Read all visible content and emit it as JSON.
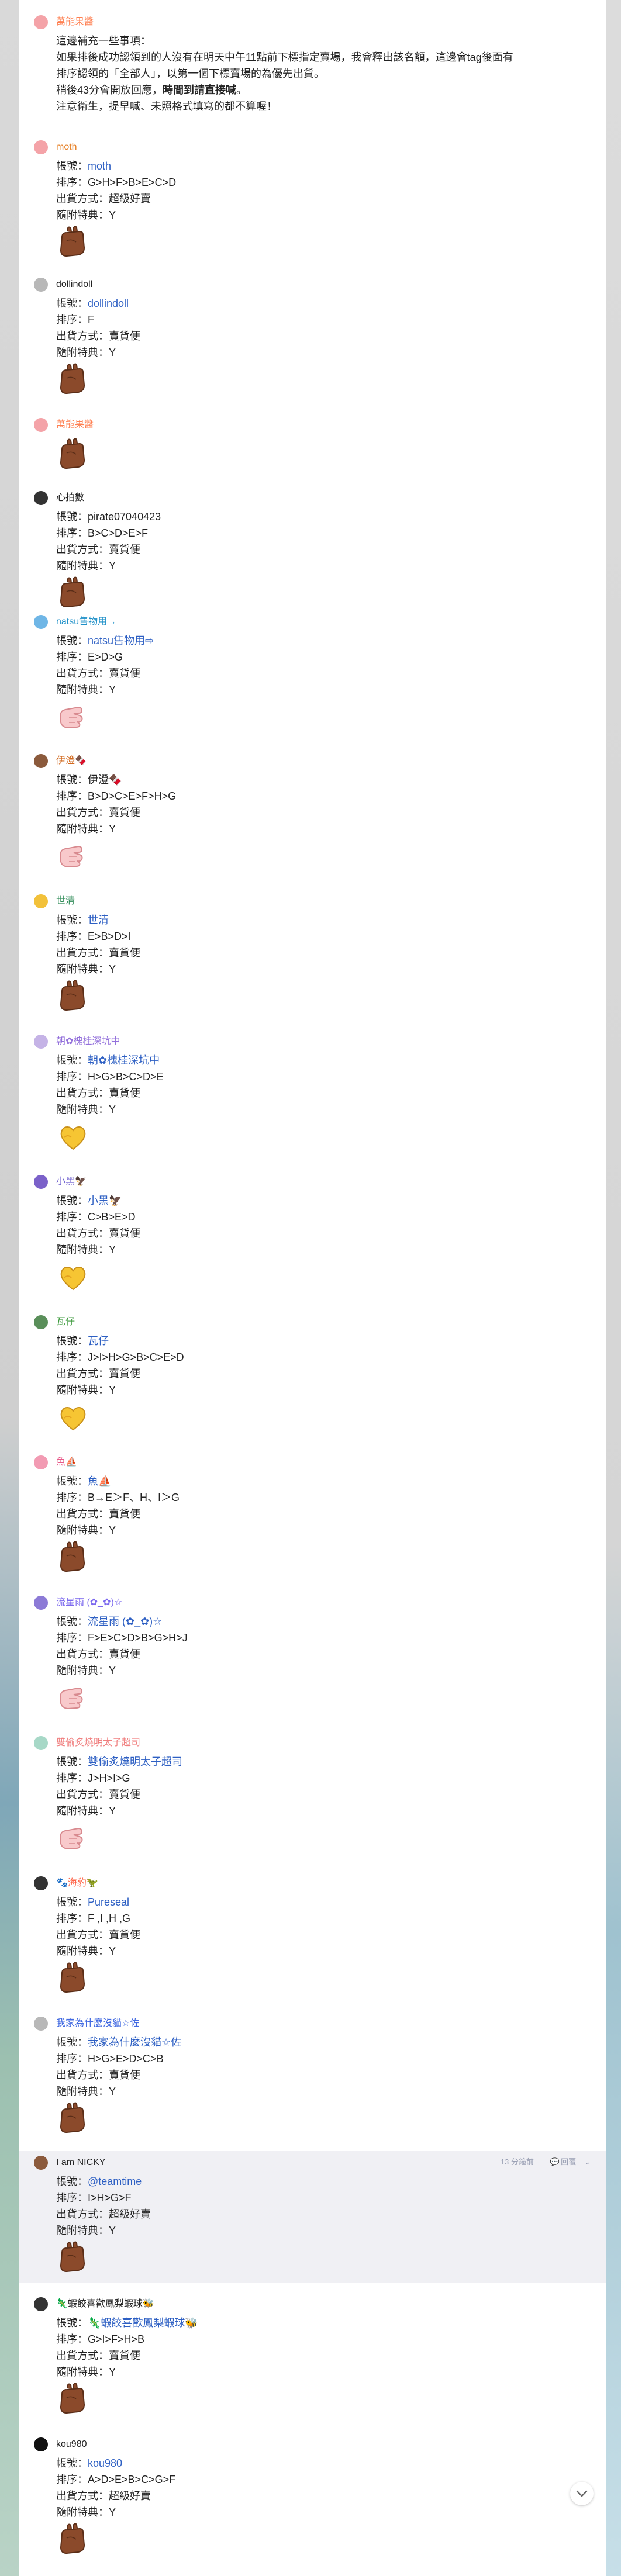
{
  "colors": {
    "link": "#2d5fc3",
    "highlight_bg": "#f0f0f4"
  },
  "messages": [
    {
      "author": "萬能果醬",
      "author_color": "#ff7f50",
      "avatar": "pink-avatar",
      "lines": [
        "這邊補充一些事項：",
        "如果排後成功認領到的人沒有在明天中午11點前下標指定賣場，我會釋出該名額，這邊會tag後面有",
        "排序認領的「全部人」，以第一個下標賣場的為優先出貨。",
        "稍後43分會開放回應，時間到請直接喊。",
        "注意衛生，提早喊、未照格式填寫的都不算喔！"
      ],
      "bold_line": {
        "before": "稍後43分會開放回應，",
        "bold": "時間到請直接喊",
        "after": "。"
      }
    },
    {
      "author": "moth",
      "author_color": "#e67e22",
      "avatar": "pink-avatar",
      "fields": [
        {
          "label": "帳號：",
          "value": "moth",
          "link": true
        },
        {
          "label": "排序：",
          "value": "G>H>F>B>E>C>D"
        },
        {
          "label": "出貨方式：",
          "value": "超級好賣"
        },
        {
          "label": "隨附特典：",
          "value": "Y"
        }
      ],
      "sticker": "brown-hand-sticker"
    },
    {
      "author": "dollindoll",
      "author_color": "#222222",
      "avatar": "gray-avatar",
      "fields": [
        {
          "label": "帳號：",
          "value": "dollindoll",
          "link": true
        },
        {
          "label": "排序：",
          "value": "F"
        },
        {
          "label": "出貨方式：",
          "value": "賣貨便"
        },
        {
          "label": "隨附特典：",
          "value": "Y"
        }
      ],
      "sticker": "brown-hand-sticker"
    },
    {
      "author": "萬能果醬",
      "author_color": "#ff7f50",
      "avatar": "pink-avatar",
      "fields": [],
      "sticker": "brown-hand-sticker"
    },
    {
      "author": "心拍數",
      "author_color": "#222222",
      "avatar": "dark-avatar",
      "fields": [
        {
          "label": "帳號：",
          "value": "pirate07040423"
        },
        {
          "label": "排序：",
          "value": "B>C>D>E>F"
        },
        {
          "label": "出貨方式：",
          "value": "賣貨便"
        },
        {
          "label": "隨附特典：",
          "value": "Y"
        }
      ],
      "sticker": "brown-hand-sticker"
    },
    {
      "author": "natsu售物用→",
      "author_color": "#1e90c8",
      "avatar": "blue-avatar",
      "fields": [
        {
          "label": "帳號：",
          "value": "natsu售物用⇨",
          "link": true
        },
        {
          "label": "排序：",
          "value": "E>D>G"
        },
        {
          "label": "出貨方式：",
          "value": "賣貨便"
        },
        {
          "label": "隨附特典：",
          "value": "Y"
        }
      ],
      "sticker": "pink-hand-sticker"
    },
    {
      "author": "伊澄🍫",
      "author_color": "#d2691e",
      "avatar": "brown-avatar",
      "fields": [
        {
          "label": "帳號：",
          "value": "伊澄🍫"
        },
        {
          "label": "排序：",
          "value": "B>D>C>E>F>H>G"
        },
        {
          "label": "出貨方式：",
          "value": "賣貨便"
        },
        {
          "label": "隨附特典：",
          "value": "Y"
        }
      ],
      "sticker": "pink-hand-sticker"
    },
    {
      "author": "世清",
      "author_color": "#2e8b57",
      "avatar": "yellow-avatar",
      "fields": [
        {
          "label": "帳號：",
          "value": "世清",
          "link": true
        },
        {
          "label": "排序：",
          "value": "E>B>D>I"
        },
        {
          "label": "出貨方式：",
          "value": "賣貨便"
        },
        {
          "label": "隨附特典：",
          "value": "Y"
        }
      ],
      "sticker": "brown-hand-sticker"
    },
    {
      "author": "朝✿槐桂深坑中",
      "author_color": "#9370db",
      "avatar": "lavender-avatar",
      "fields": [
        {
          "label": "帳號：",
          "value": "朝✿槐桂深坑中",
          "link": true
        },
        {
          "label": "排序：",
          "value": "H>G>B>C>D>E"
        },
        {
          "label": "出貨方式：",
          "value": "賣貨便"
        },
        {
          "label": "隨附特典：",
          "value": "Y"
        }
      ],
      "sticker": "yellow-heart-sticker"
    },
    {
      "author": "小黑🦅",
      "author_color": "#6a5acd",
      "avatar": "purple-avatar",
      "fields": [
        {
          "label": "帳號：",
          "value": "小黑🦅",
          "link": true
        },
        {
          "label": "排序：",
          "value": "C>B>E>D"
        },
        {
          "label": "出貨方式：",
          "value": "賣貨便"
        },
        {
          "label": "隨附特典：",
          "value": "Y"
        }
      ],
      "sticker": "yellow-heart-sticker"
    },
    {
      "author": "瓦仔",
      "author_color": "#3c9a3c",
      "avatar": "green-avatar",
      "fields": [
        {
          "label": "帳號：",
          "value": "瓦仔",
          "link": true
        },
        {
          "label": "排序：",
          "value": "J>I>H>G>B>C>E>D"
        },
        {
          "label": "出貨方式：",
          "value": "賣貨便"
        },
        {
          "label": "隨附特典：",
          "value": "Y"
        }
      ],
      "sticker": "yellow-heart-sticker"
    },
    {
      "author": "魚⛵",
      "author_color": "#e85a8a",
      "avatar": "rose-avatar",
      "fields": [
        {
          "label": "帳號：",
          "value": "魚⛵",
          "link": true
        },
        {
          "label": "排序：",
          "value": "B→E＞F、H、I＞G"
        },
        {
          "label": "出貨方式：",
          "value": "賣貨便"
        },
        {
          "label": "隨附特典：",
          "value": "Y"
        }
      ],
      "sticker": "brown-hand-sticker"
    },
    {
      "author": "流星雨 (✿_✿)☆",
      "author_color": "#7b68ee",
      "avatar": "violet-avatar",
      "fields": [
        {
          "label": "帳號：",
          "value": "流星雨 (✿_✿)☆",
          "link": true
        },
        {
          "label": "排序：",
          "value": "F>E>C>D>B>G>H>J"
        },
        {
          "label": "出貨方式：",
          "value": "賣貨便"
        },
        {
          "label": "隨附特典：",
          "value": "Y"
        }
      ],
      "sticker": "pink-hand-sticker"
    },
    {
      "author": "雙偷炙燒明太子超司",
      "author_color": "#f08080",
      "avatar": "mint-avatar",
      "fields": [
        {
          "label": "帳號：",
          "value": "雙偷炙燒明太子超司",
          "link": true
        },
        {
          "label": "排序：",
          "value": "J>H>I>G"
        },
        {
          "label": "出貨方式：",
          "value": "賣貨便"
        },
        {
          "label": "隨附特典：",
          "value": "Y"
        }
      ],
      "sticker": "pink-hand-sticker"
    },
    {
      "author": "🐾海豹🦖",
      "author_color": "#ff6347",
      "avatar": "dark-avatar",
      "fields": [
        {
          "label": "帳號：",
          "value": "Pureseal",
          "link": true
        },
        {
          "label": "排序：",
          "value": "F ,I ,H ,G"
        },
        {
          "label": "出貨方式：",
          "value": "賣貨便"
        },
        {
          "label": "隨附特典：",
          "value": "Y"
        }
      ],
      "sticker": "brown-hand-sticker"
    },
    {
      "author": "我家為什麼沒貓☆佐",
      "author_color": "#4169e1",
      "avatar": "gray-avatar",
      "fields": [
        {
          "label": "帳號：",
          "value": "我家為什麼沒貓☆佐",
          "link": true
        },
        {
          "label": "排序：",
          "value": "H>G>E>D>C>B"
        },
        {
          "label": "出貨方式：",
          "value": "賣貨便"
        },
        {
          "label": "隨附特典：",
          "value": "Y"
        }
      ],
      "sticker": "brown-hand-sticker"
    },
    {
      "author": "I am NICKY",
      "author_color": "#222222",
      "avatar": "brown-avatar",
      "highlight": true,
      "tools": {
        "time": "13 分鐘前",
        "reply": "回覆"
      },
      "fields": [
        {
          "label": "帳號：",
          "value": "@teamtime",
          "link": true
        },
        {
          "label": "排序：",
          "value": "I>H>G>F"
        },
        {
          "label": "出貨方式：",
          "value": "超級好賣"
        },
        {
          "label": "隨附特典：",
          "value": "Y"
        }
      ],
      "sticker": "brown-hand-sticker"
    },
    {
      "author": "🦎蝦餃喜歡鳳梨蝦球🐝",
      "author_color": "#222222",
      "avatar": "dark-avatar",
      "fields": [
        {
          "label": "帳號：",
          "value": "🦎蝦餃喜歡鳳梨蝦球🐝",
          "link": true
        },
        {
          "label": "排序：",
          "value": "G>I>F>H>B"
        },
        {
          "label": "出貨方式：",
          "value": "賣貨便"
        },
        {
          "label": "隨附特典：",
          "value": "Y"
        }
      ],
      "sticker": "brown-hand-sticker"
    },
    {
      "author": "kou980",
      "author_color": "#222222",
      "avatar": "black-avatar",
      "fields": [
        {
          "label": "帳號：",
          "value": "kou980",
          "link": true
        },
        {
          "label": "排序：",
          "value": "A>D>E>B>C>G>F"
        },
        {
          "label": "出貨方式：",
          "value": "超級好賣"
        },
        {
          "label": "隨附特典：",
          "value": "Y"
        }
      ],
      "sticker": "brown-hand-sticker"
    }
  ],
  "icons": {
    "scroll_down": "chevron-down-icon",
    "reply": "reply-icon",
    "more": "chevron-down-icon"
  }
}
